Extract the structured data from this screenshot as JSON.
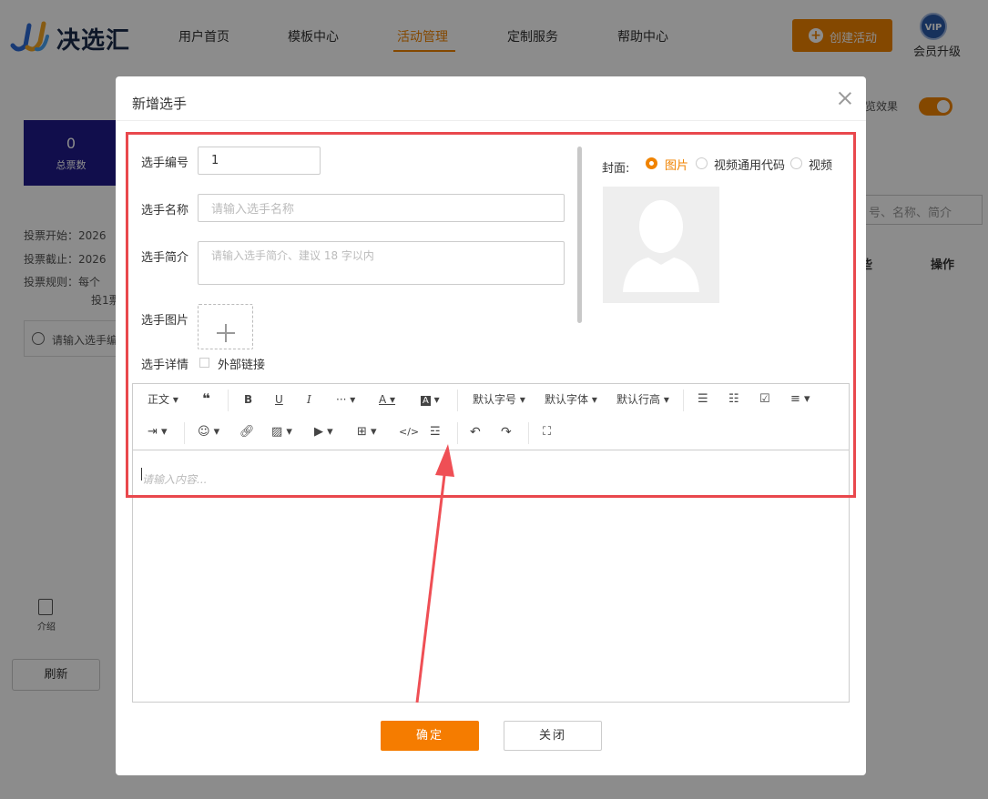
{
  "brand": {
    "name": "决选汇"
  },
  "nav": {
    "items": [
      "用户首页",
      "模板中心",
      "活动管理",
      "定制服务",
      "帮助中心"
    ],
    "active_index": 2
  },
  "header": {
    "create_label": "创建活动",
    "vip_badge": "VIP",
    "vip_label": "会员升级"
  },
  "background": {
    "stat_value": "0",
    "stat_label": "总票数",
    "vote_start": "投票开始：2026",
    "vote_end": "投票截止：2026",
    "vote_rule": "投票规则：每个",
    "vote_rule_cont": "投1票",
    "search_placeholder": "请输入选手编",
    "preview_label": "览效果",
    "right_search_placeholder": "号、名称、简介",
    "col_partial": "些",
    "col_op": "操作",
    "intro_label": "介绍",
    "refresh_label": "刷新"
  },
  "modal": {
    "title": "新增选手",
    "fields": {
      "number_label": "选手编号",
      "number_value": "1",
      "name_label": "选手名称",
      "name_placeholder": "请输入选手名称",
      "intro_label": "选手简介",
      "intro_placeholder": "请输入选手简介、建议 18 字以内",
      "image_label": "选手图片",
      "detail_label": "选手详情",
      "external_link_label": "外部链接"
    },
    "cover": {
      "label": "封面:",
      "options": [
        "图片",
        "视频通用代码",
        "视频"
      ],
      "selected_index": 0
    },
    "editor": {
      "toolbar_row1": [
        "正文",
        "默认字号",
        "默认字体",
        "默认行高"
      ],
      "placeholder": "请输入内容..."
    },
    "buttons": {
      "ok": "确定",
      "close": "关闭"
    }
  },
  "colors": {
    "accent": "#f08300",
    "highlight": "#e9484d",
    "stat_bg": "#1f1a8a"
  }
}
